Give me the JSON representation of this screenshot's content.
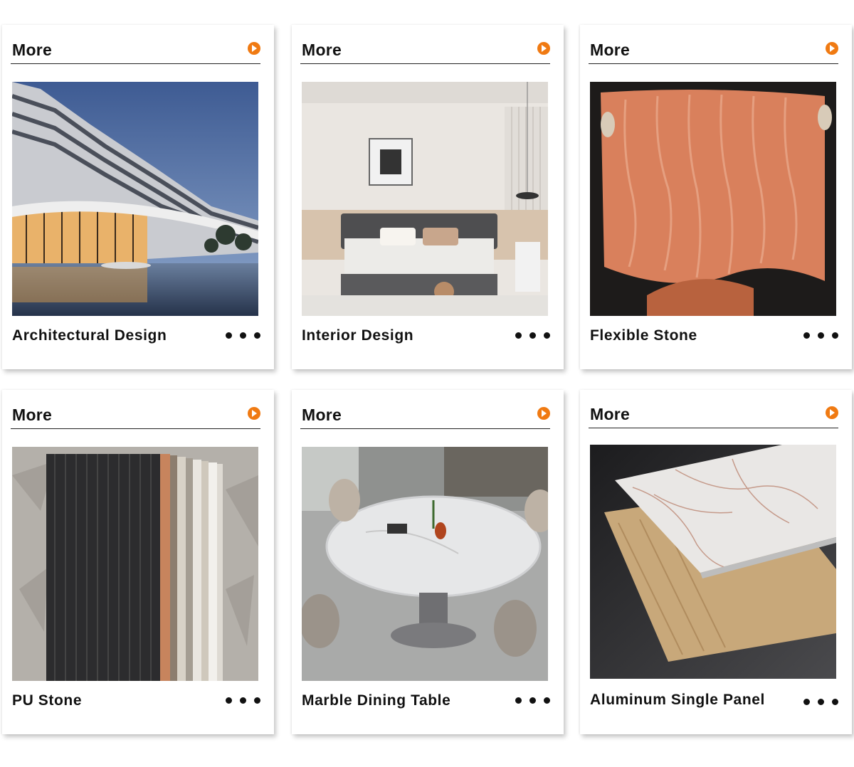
{
  "accent_color": "#f07a12",
  "cards": [
    {
      "more_label": "More",
      "title": "Architectural Design",
      "arrow_icon": "play-circle-icon",
      "more_icon": "ellipsis-icon"
    },
    {
      "more_label": "More",
      "title": "Interior Design",
      "arrow_icon": "play-circle-icon",
      "more_icon": "ellipsis-icon"
    },
    {
      "more_label": "More",
      "title": "Flexible Stone",
      "arrow_icon": "play-circle-icon",
      "more_icon": "ellipsis-icon"
    },
    {
      "more_label": "More",
      "title": "PU Stone",
      "arrow_icon": "play-circle-icon",
      "more_icon": "ellipsis-icon"
    },
    {
      "more_label": "More",
      "title": "Marble Dining Table",
      "arrow_icon": "play-circle-icon",
      "more_icon": "ellipsis-icon"
    },
    {
      "more_label": "More",
      "title": "Aluminum Single Panel",
      "arrow_icon": "play-circle-icon",
      "more_icon": "ellipsis-icon"
    }
  ]
}
